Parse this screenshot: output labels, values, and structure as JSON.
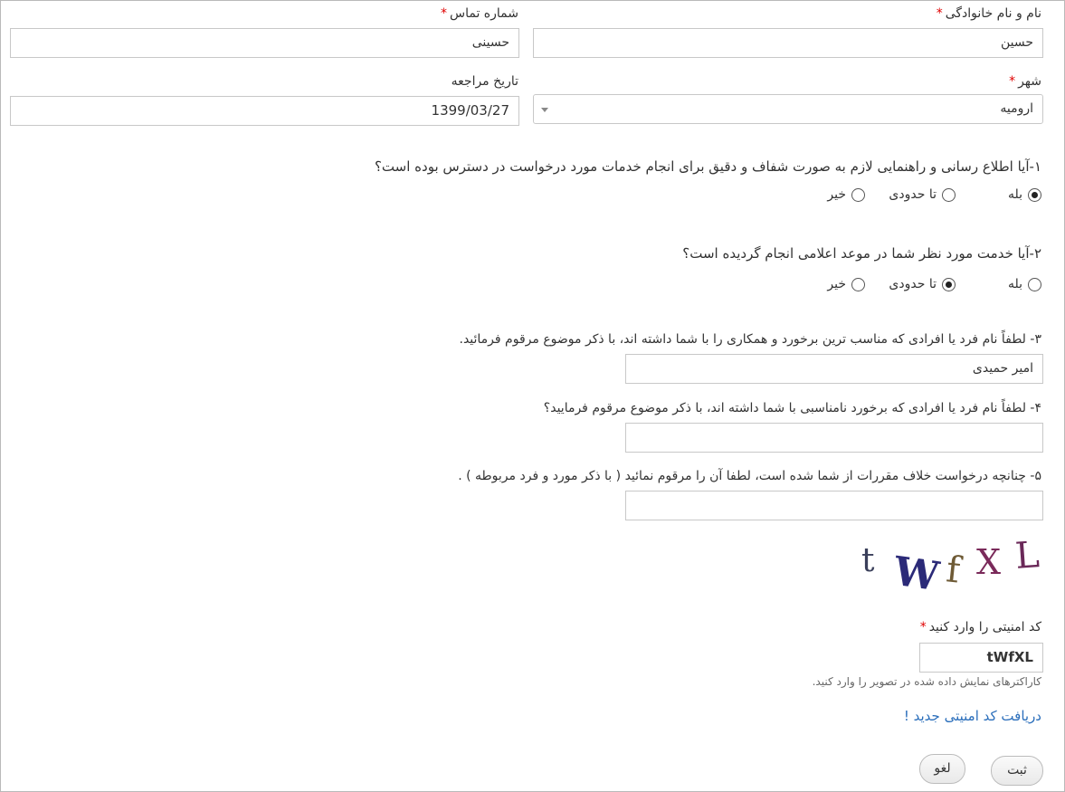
{
  "form": {
    "fullname": {
      "label": "نام و نام خانوادگی",
      "required_mark": "*",
      "value": "حسین"
    },
    "phone": {
      "label": "شماره تماس",
      "required_mark": "*",
      "value": "حسینی"
    },
    "city": {
      "label": "شهر",
      "required_mark": "*",
      "value": "ارومیه"
    },
    "visit_date": {
      "label": "تاریخ مراجعه",
      "value": "1399/03/27"
    },
    "q1": {
      "text": "۱-آیا اطلاع رسانی و راهنمایی لازم به صورت شفاف و دقیق برای انجام خدمات مورد درخواست در دسترس بوده است؟",
      "options": [
        "بله",
        "تا حدودی",
        "خیر"
      ],
      "selected": "بله"
    },
    "q2": {
      "text": "۲-آیا خدمت مورد نظر شما در موعد اعلامی انجام گردیده است؟",
      "options": [
        "بله",
        "تا حدودی",
        "خیر"
      ],
      "selected": "تا حدودی"
    },
    "q3": {
      "text": "۳- لطفاً نام فرد یا افرادی که مناسب ترین برخورد و همکاری را با شما داشته اند، با ذکر موضوع مرقوم فرمائید.",
      "value": "امیر حمیدی"
    },
    "q4": {
      "text": "۴- لطفاً نام فرد یا افرادی که برخورد نامناسبی با شما داشته اند، با ذکر موضوع مرقوم فرمایید؟",
      "value": ""
    },
    "q5": {
      "text": "۵- چنانچه درخواست خلاف مقررات از شما شده است، لطفا آن را مرقوم نمائید ( با ذکر مورد و فرد مربوطه ) .",
      "value": ""
    },
    "captcha": {
      "chars": [
        "t",
        "W",
        "f",
        "X",
        "L"
      ],
      "label": "کد امنیتی را وارد کنید",
      "required_mark": "*",
      "value": "tWfXL",
      "hint": "کاراکترهای نمایش داده شده در تصویر را وارد کنید.",
      "refresh_link": "دریافت کد امنیتی جدید !"
    },
    "buttons": {
      "submit": "ثبت",
      "cancel": "لغو"
    }
  }
}
